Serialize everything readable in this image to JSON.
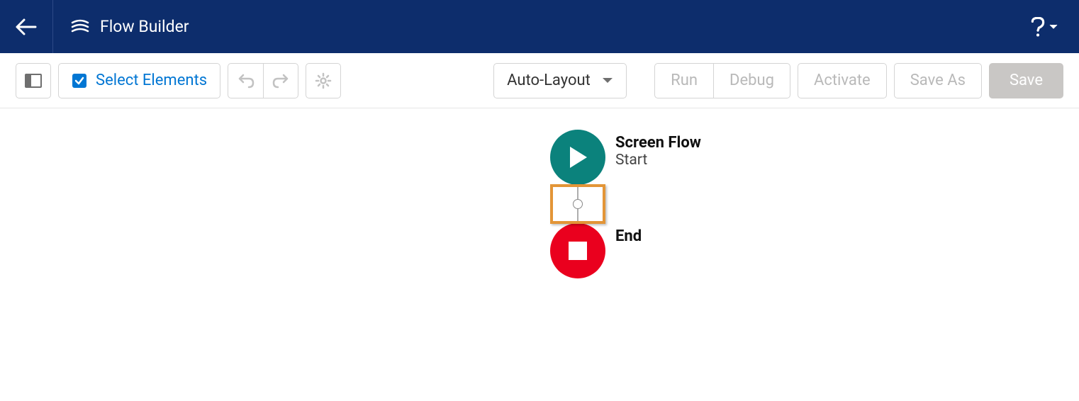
{
  "header": {
    "title": "Flow Builder"
  },
  "toolbar": {
    "select_elements": "Select Elements",
    "layout_mode": "Auto-Layout",
    "run": "Run",
    "debug": "Debug",
    "activate": "Activate",
    "save_as": "Save As",
    "save": "Save"
  },
  "nodes": {
    "start": {
      "title": "Screen Flow",
      "subtitle": "Start"
    },
    "end": {
      "title": "End"
    }
  },
  "colors": {
    "header_bg": "#0d2d6c",
    "start_node": "#0b827c",
    "end_node": "#ea001e",
    "highlight": "#e39537",
    "link": "#0176d3"
  }
}
